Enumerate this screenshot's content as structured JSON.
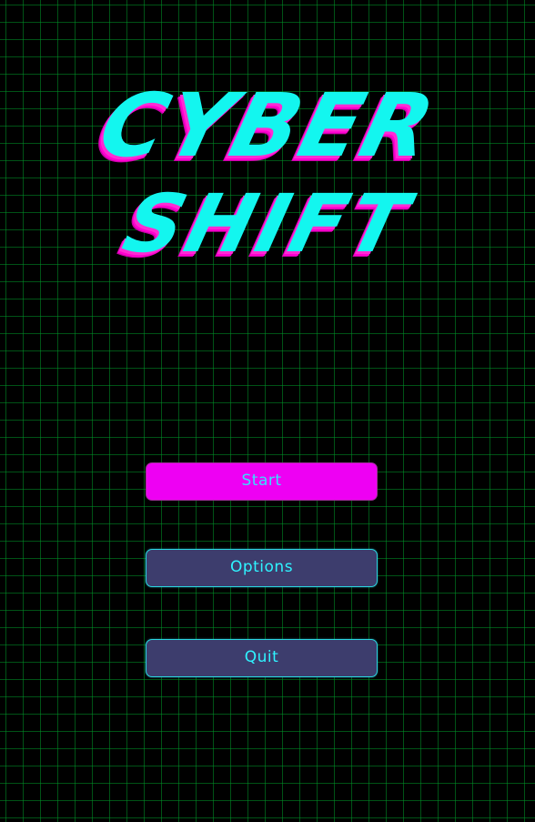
{
  "title": {
    "line1": "Cyber",
    "line2": "Shift"
  },
  "menu": {
    "start_label": "Start",
    "options_label": "Options",
    "quit_label": "Quit"
  },
  "colors": {
    "background": "#000000",
    "grid": "#009628",
    "title_fill": "#13f6ef",
    "title_shadow": "#ff00d0",
    "button_primary_bg": "#ee00f3",
    "button_secondary_bg": "#3d3d6d",
    "button_text": "#2ff3ff"
  }
}
